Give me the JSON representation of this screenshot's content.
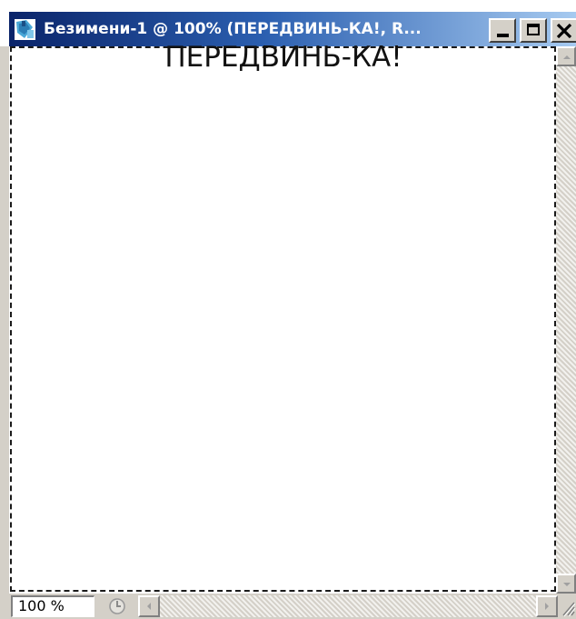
{
  "window": {
    "title": "Безимени-1 @ 100% (ПЕРЕДВИНЬ-КА!, R...",
    "icon": "photoshop-document-icon",
    "controls": {
      "minimize_icon": "minimize-icon",
      "maximize_icon": "maximize-icon",
      "close_icon": "close-icon"
    }
  },
  "canvas": {
    "text": "ПЕРЕДВИНЬ-КА!",
    "selection": "dashed-marquee"
  },
  "statusbar": {
    "zoom": "100 %",
    "info_icon": "status-info-icon"
  },
  "scrollbars": {
    "up_icon": "scroll-up-arrow-icon",
    "down_icon": "scroll-down-arrow-icon",
    "left_icon": "scroll-left-arrow-icon",
    "right_icon": "scroll-right-arrow-icon"
  },
  "colors": {
    "titlebar_start": "#0a246a",
    "titlebar_end": "#a6caf0",
    "chrome": "#d4d0c8",
    "canvas": "#ffffff"
  }
}
